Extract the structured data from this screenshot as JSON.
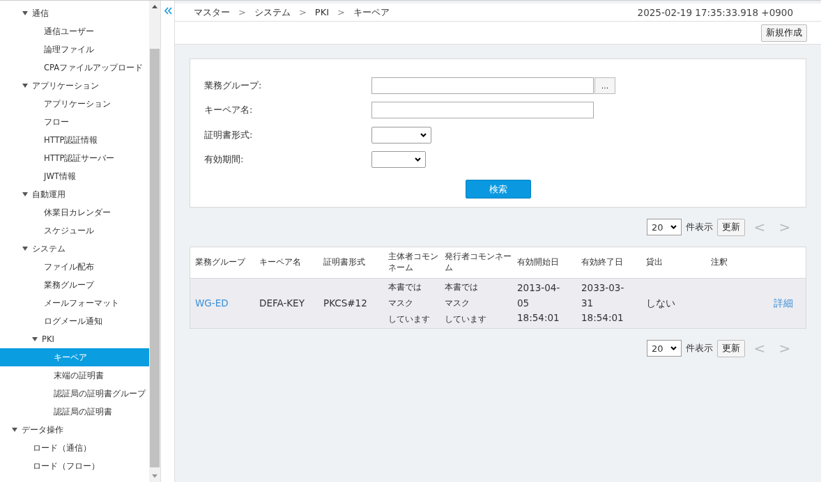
{
  "sidebar": {
    "tree_continued": [
      {
        "label": "通信",
        "expanded": true,
        "children": [
          {
            "label": "通信ユーザー",
            "selected": false
          },
          {
            "label": "論理ファイル",
            "selected": false
          },
          {
            "label": "CPAファイルアップロード",
            "selected": false
          }
        ]
      },
      {
        "label": "アプリケーション",
        "expanded": true,
        "children": [
          {
            "label": "アプリケーション",
            "selected": false
          },
          {
            "label": "フロー",
            "selected": false
          },
          {
            "label": "HTTP認証情報",
            "selected": false
          },
          {
            "label": "HTTP認証サーバー",
            "selected": false
          },
          {
            "label": "JWT情報",
            "selected": false
          }
        ]
      },
      {
        "label": "自動運用",
        "expanded": true,
        "children": [
          {
            "label": "休業日カレンダー",
            "selected": false
          },
          {
            "label": "スケジュール",
            "selected": false
          }
        ]
      },
      {
        "label": "システム",
        "expanded": true,
        "children": [
          {
            "label": "ファイル配布",
            "selected": false
          },
          {
            "label": "業務グループ",
            "selected": false
          },
          {
            "label": "メールフォーマット",
            "selected": false
          },
          {
            "label": "ログメール通知",
            "selected": false
          },
          {
            "label": "PKI",
            "expanded": true,
            "children": [
              {
                "label": "キーペア",
                "selected": true
              },
              {
                "label": "末端の証明書",
                "selected": false
              },
              {
                "label": "認証局の証明書グループ",
                "selected": false
              },
              {
                "label": "認証局の証明書",
                "selected": false
              }
            ]
          }
        ]
      }
    ],
    "tree": [
      {
        "label": "データ操作",
        "expanded": true,
        "children": [
          {
            "label": "ロード（通信）",
            "selected": false
          },
          {
            "label": "ロード（フロー）",
            "selected": false
          }
        ]
      }
    ]
  },
  "breadcrumb": [
    "マスター",
    "システム",
    "PKI",
    "キーペア"
  ],
  "breadcrumb_separator": ">",
  "timestamp": "2025-02-19 17:35:33.918 +0900",
  "new_button": "新規作成",
  "form": {
    "fields": [
      {
        "kind": "picker",
        "label": "業務グループ:",
        "button": "…"
      },
      {
        "kind": "text",
        "label": "キーペア名:"
      },
      {
        "kind": "select",
        "label": "証明書形式:"
      },
      {
        "kind": "select",
        "label": "有効期間:"
      }
    ],
    "search_button": "検索"
  },
  "pager_top": {
    "page_size": "20",
    "per_page_label": "件表示",
    "refresh": "更新",
    "prev": "<",
    "next": ">"
  },
  "table": {
    "columns": [
      "業務グループ",
      "キーペア名",
      "証明書形式",
      "主体者コモンネーム",
      "発行者コモンネーム",
      "有効開始日",
      "有効終了日",
      "貸出",
      "注釈"
    ],
    "rows": [
      {
        "cells": [
          "WG-ED",
          "DEFA-KEY",
          "PKCS#12",
          [
            "本書では",
            "マスク",
            "しています"
          ],
          [
            "本書では",
            "マスク",
            "しています"
          ],
          "2013-04-\n05\n18:54:01",
          "2033-03-\n31\n18:54:01",
          "しない"
        ],
        "action": "詳細"
      }
    ]
  },
  "pager_bottom": {
    "page_size": "20",
    "per_page_label": "件表示",
    "refresh": "更新",
    "prev": "<",
    "next": ">"
  }
}
